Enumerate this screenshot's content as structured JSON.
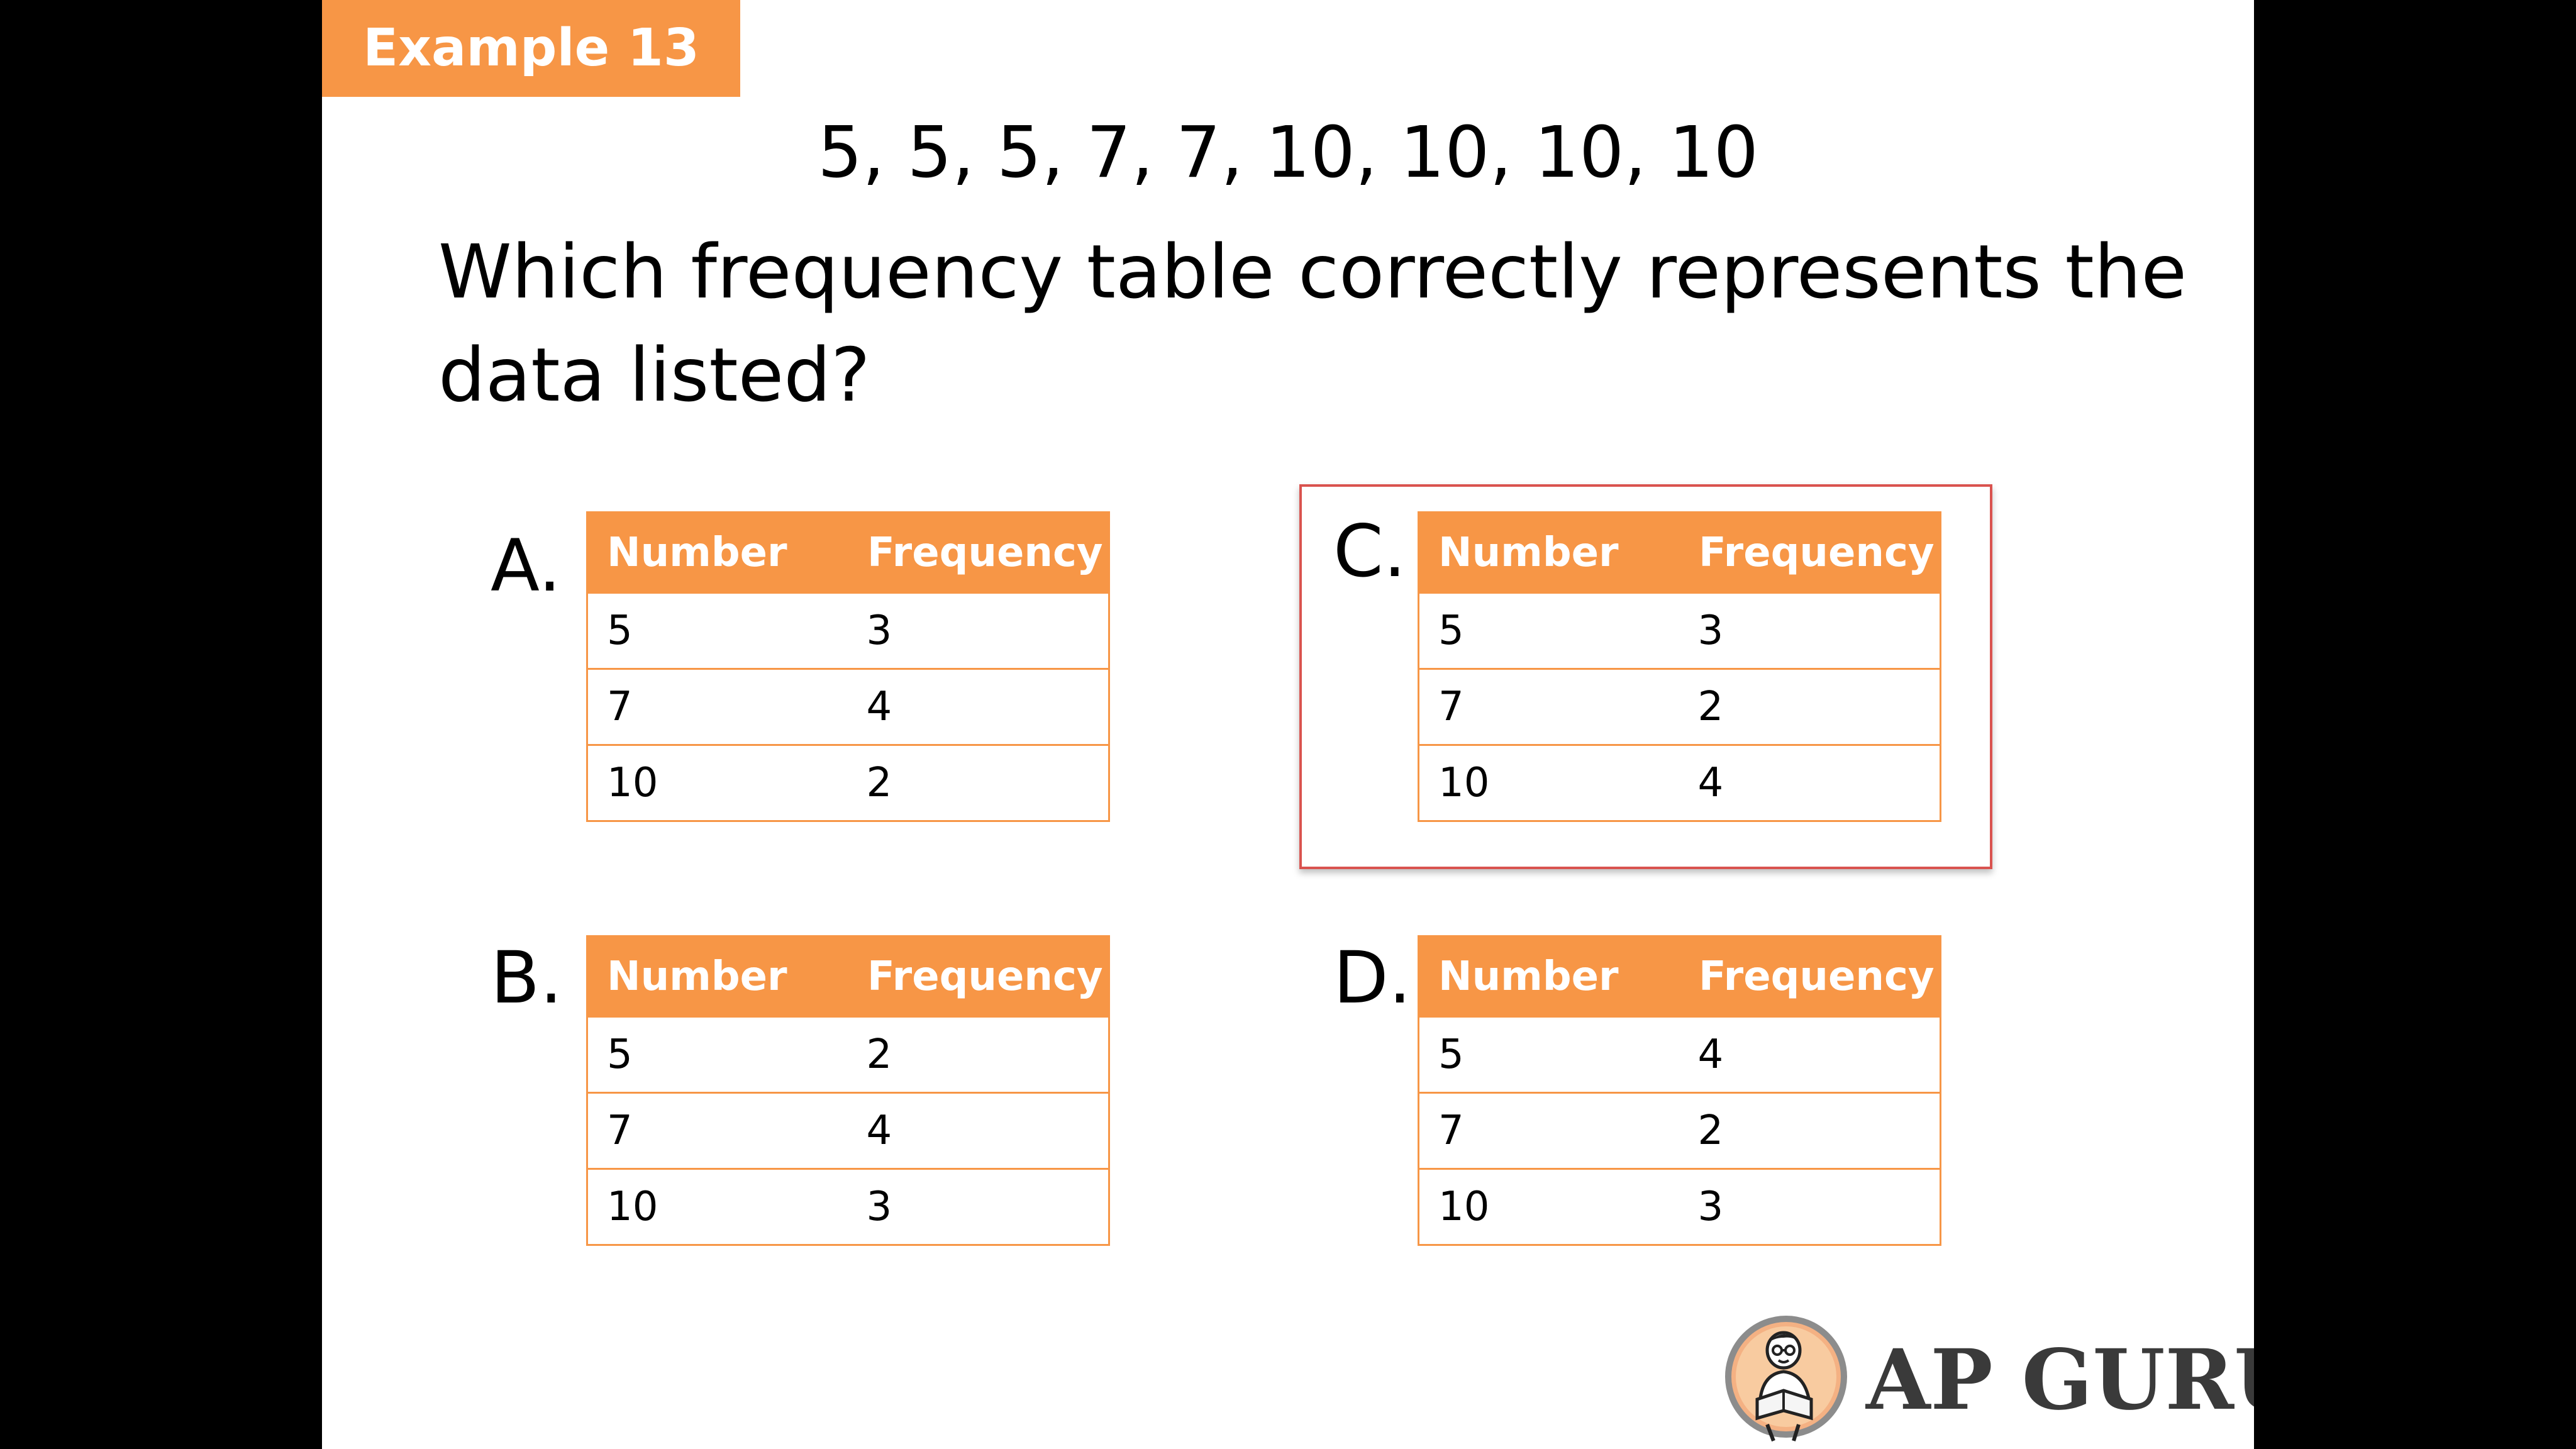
{
  "slide": {
    "tag": "Example 13",
    "sequence": "5, 5, 5, 7, 7, 10, 10, 10, 10",
    "question": "Which frequency table correctly represents the data listed?"
  },
  "options": {
    "A": {
      "letter": "A.",
      "headers": [
        "Number",
        "Frequency"
      ],
      "rows": [
        [
          "5",
          "3"
        ],
        [
          "7",
          "4"
        ],
        [
          "10",
          "2"
        ]
      ]
    },
    "B": {
      "letter": "B.",
      "headers": [
        "Number",
        "Frequency"
      ],
      "rows": [
        [
          "5",
          "2"
        ],
        [
          "7",
          "4"
        ],
        [
          "10",
          "3"
        ]
      ]
    },
    "C": {
      "letter": "C.",
      "headers": [
        "Number",
        "Frequency"
      ],
      "rows": [
        [
          "5",
          "3"
        ],
        [
          "7",
          "2"
        ],
        [
          "10",
          "4"
        ]
      ],
      "highlighted": true
    },
    "D": {
      "letter": "D.",
      "headers": [
        "Number",
        "Frequency"
      ],
      "rows": [
        [
          "5",
          "4"
        ],
        [
          "7",
          "2"
        ],
        [
          "10",
          "3"
        ]
      ]
    }
  },
  "logo": {
    "text": "AP GURU",
    "icon": "reading-person-icon"
  },
  "colors": {
    "accent": "#F79646",
    "highlight_border": "#D9534F",
    "background": "#ffffff",
    "letterbox": "#000000"
  }
}
